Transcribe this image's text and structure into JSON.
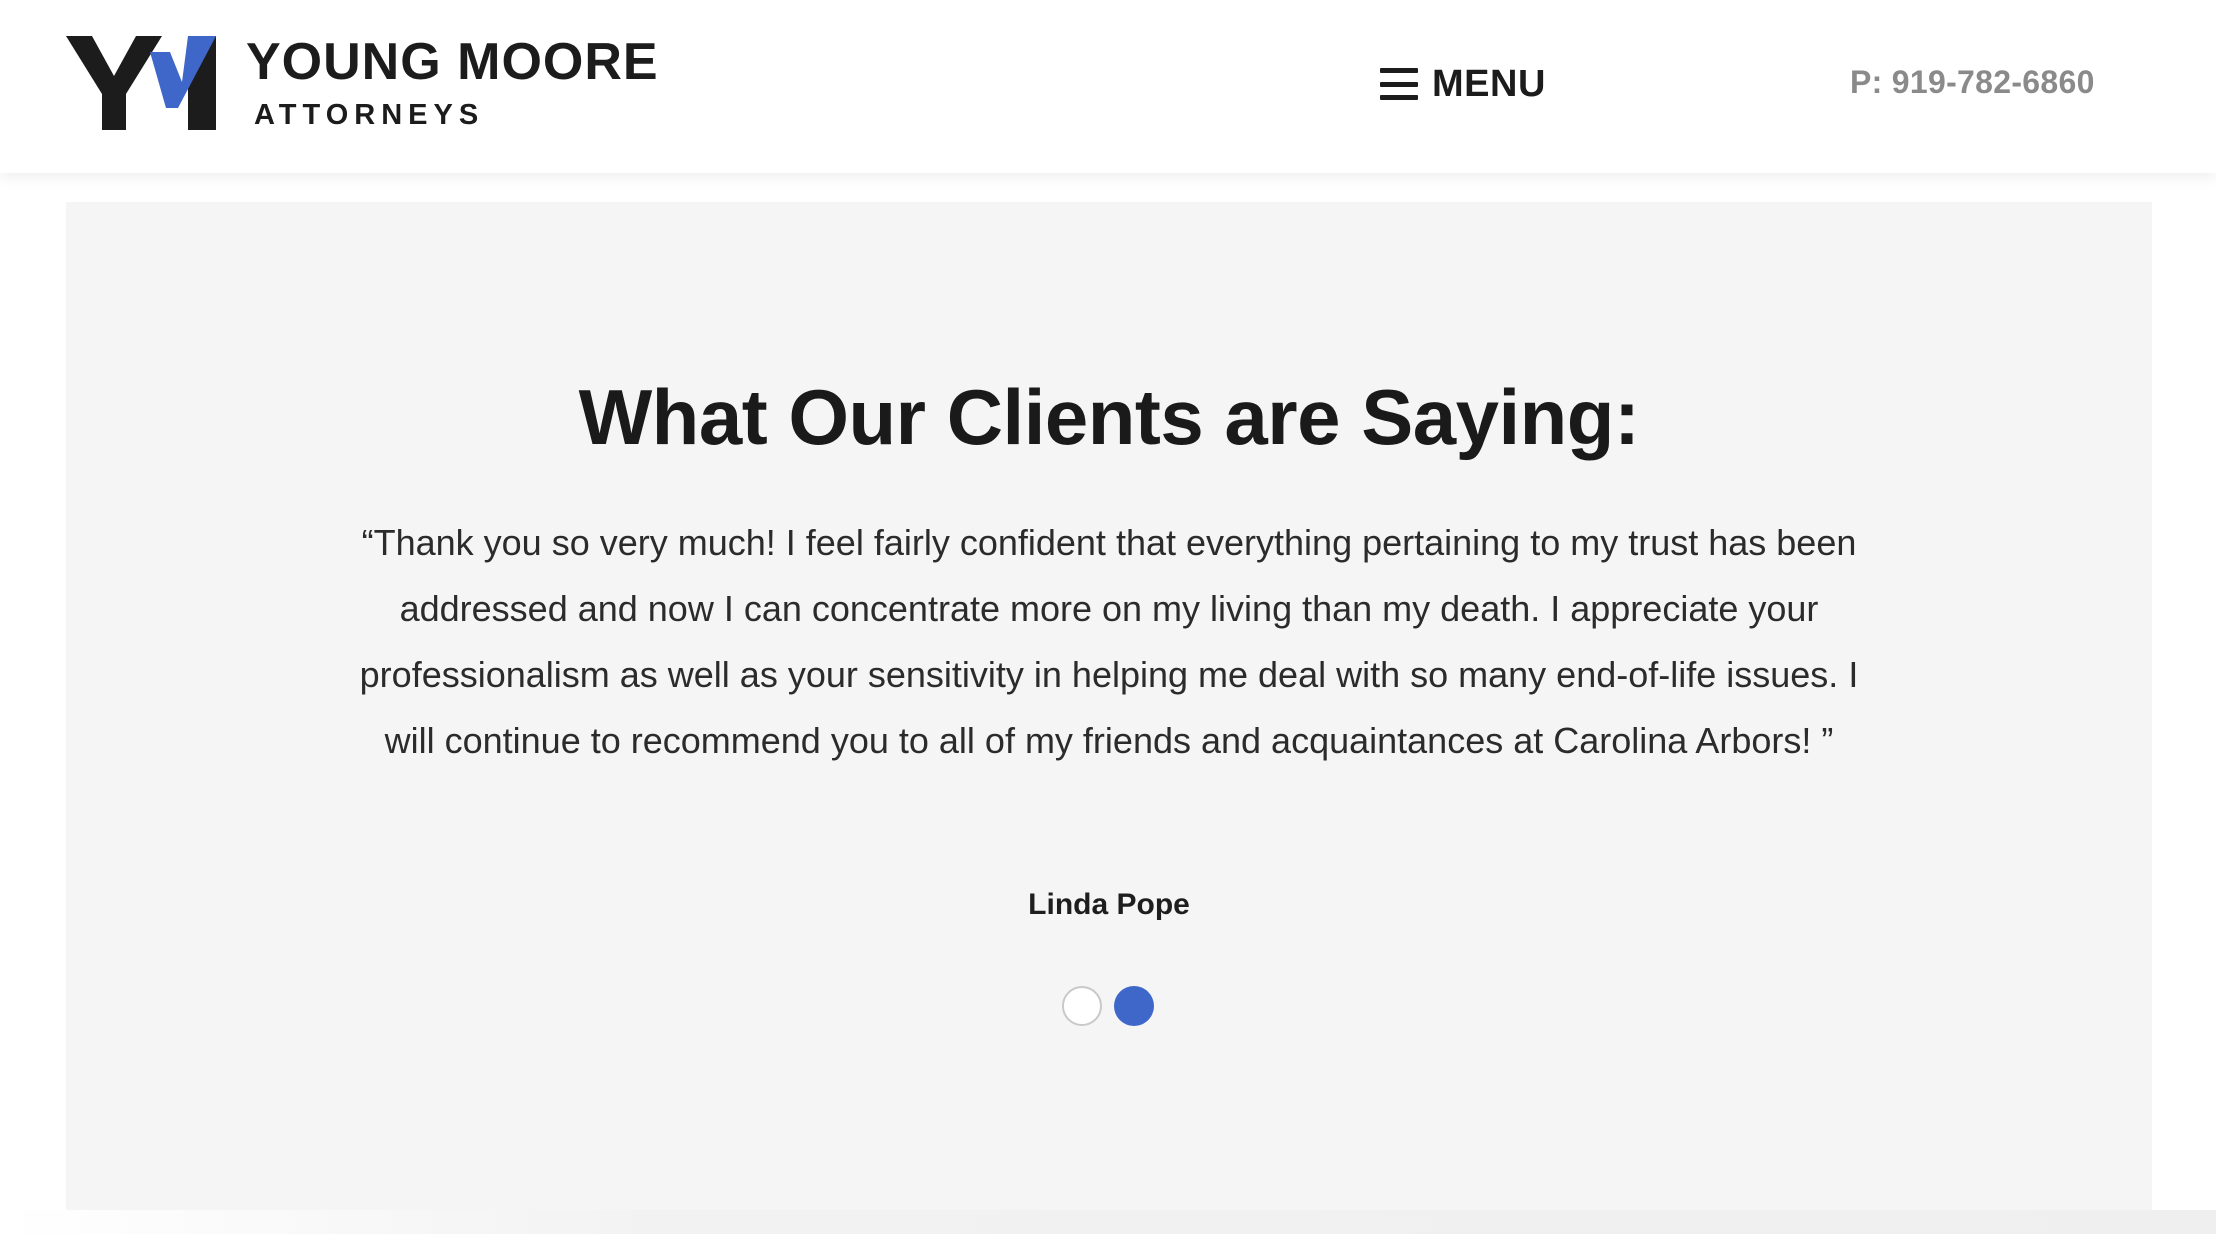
{
  "header": {
    "logo": {
      "name": "YOUNG MOORE",
      "subtitle": "ATTORNEYS",
      "mark_colors": {
        "dark": "#1c1c1c",
        "accent": "#3f67c9"
      }
    },
    "menu": {
      "label": "MENU",
      "icon": "hamburger-icon"
    },
    "phone": "P: 919-782-6860"
  },
  "testimonial": {
    "title": "What Our Clients are Saying:",
    "quote": "“Thank you so very much! I feel fairly confident that everything pertaining to my trust has been addressed and now I can concentrate more on my living than my death. I appreciate your professionalism as well as your sensitivity in helping me deal with so many end-of-life issues. I will continue to recommend you to all of my friends and acquaintances at Carolina Arbors! ”",
    "author": "Linda Pope",
    "slides": {
      "count": 2,
      "active": 2
    }
  },
  "colors": {
    "accent": "#3f67c9",
    "section_background": "#f5f5f5",
    "phone_text": "#8a8a8a"
  }
}
